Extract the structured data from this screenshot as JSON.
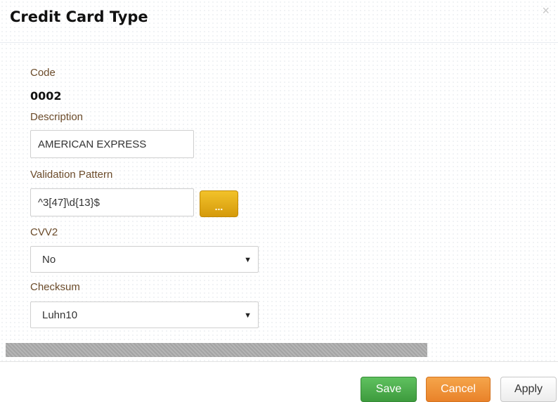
{
  "dialog": {
    "title": "Credit Card Type",
    "close_icon": "close-icon"
  },
  "form": {
    "code_label": "Code",
    "code_value": "0002",
    "description_label": "Description",
    "description_value": "AMERICAN EXPRESS",
    "validation_label": "Validation Pattern",
    "validation_value": "^3[47]\\d{13}$",
    "ellipsis_label": "...",
    "cvv2_label": "CVV2",
    "cvv2_value": "No",
    "checksum_label": "Checksum",
    "checksum_value": "Luhn10"
  },
  "footer": {
    "save_label": "Save",
    "cancel_label": "Cancel",
    "apply_label": "Apply"
  },
  "colors": {
    "save": "#4cae4c",
    "cancel": "#f0932b",
    "ellipsis": "#e6ad18",
    "label": "#6b4b2a"
  }
}
